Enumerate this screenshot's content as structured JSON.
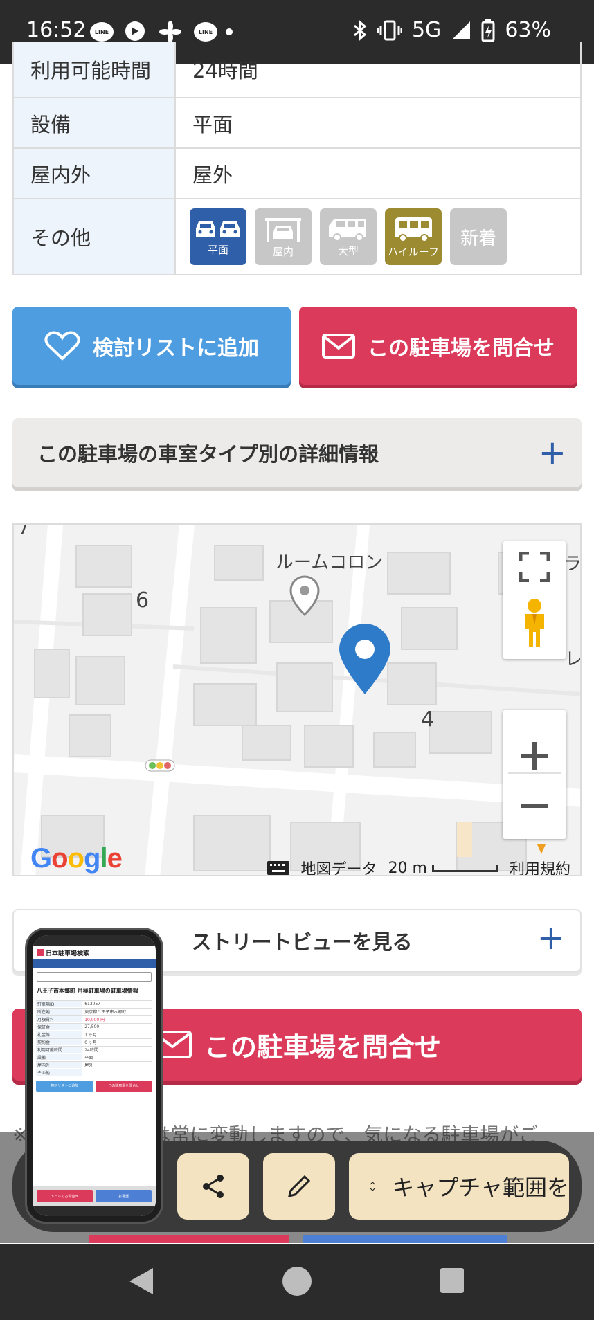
{
  "status_bar": {
    "time": "16:52",
    "network": "5G",
    "battery": "63%",
    "left_icons": [
      "line-icon",
      "chat-icon",
      "pinwheel-icon",
      "line-icon",
      "dot-icon"
    ],
    "right_icons": [
      "bluetooth-icon",
      "vibrate-icon",
      "signal-icon",
      "battery-icon"
    ]
  },
  "detail_table": {
    "rows": [
      {
        "label": "利用可能時間",
        "value": "24時間"
      },
      {
        "label": "設備",
        "value": "平面"
      },
      {
        "label": "屋内外",
        "value": "屋外"
      },
      {
        "label": "その他",
        "value": ""
      }
    ],
    "tags": [
      {
        "label": "平面",
        "state": "active",
        "icon": "flat-parking-icon"
      },
      {
        "label": "屋内",
        "state": "inactive",
        "icon": "indoor-parking-icon"
      },
      {
        "label": "大型",
        "state": "inactive",
        "icon": "large-vehicle-icon"
      },
      {
        "label": "ハイルーフ",
        "state": "active",
        "icon": "high-roof-icon"
      },
      {
        "label": "新着",
        "state": "inactive",
        "icon": ""
      }
    ]
  },
  "actions": {
    "favorite_label": "検討リストに追加",
    "inquiry_label": "この駐車場を問合せ"
  },
  "detail_accordion": {
    "title": "この駐車場の車室タイプ別の詳細情報",
    "toggle": "+"
  },
  "map": {
    "labels": [
      "ルームコロン",
      "6",
      "4",
      "ラ",
      "レ",
      "7"
    ],
    "attribution": "地図データ",
    "scale": "20 m",
    "terms": "利用規約",
    "logo": "Google"
  },
  "street_view": {
    "label": "ストリートビューを見る",
    "toggle": "+"
  },
  "bottom_inquiry": {
    "label": "この駐車場を問合せ"
  },
  "note": "※ 　　　　　報は常に変動しますので、気になる駐車場がご",
  "capture_toolbar": {
    "range_label": "キャプチャ範囲を"
  },
  "thumbnail": {
    "site_name": "日本駐車場検索",
    "title": "八王子市本郷町 月極駐車場の駐車場情報",
    "rows": [
      [
        "駐車場ID",
        "613057"
      ],
      [
        "所在地",
        "東京都八王子市本郷町"
      ],
      [
        "月額賃料",
        "10,000 円"
      ],
      [
        "保証金",
        "27,500"
      ],
      [
        "礼金等",
        "1 ヶ月"
      ],
      [
        "契約金",
        "0 ヶ月"
      ],
      [
        "利用可能時間",
        "24時間"
      ],
      [
        "設備",
        "平面"
      ],
      [
        "屋内外",
        "屋外"
      ],
      [
        "その他",
        ""
      ]
    ],
    "fav": "検討リストに追加",
    "inq": "この駐車場を問合せ",
    "mail": "メールでお問合せ",
    "phone": "お電話"
  },
  "colors": {
    "primary_blue": "#2f5fa8",
    "fav_blue": "#4d9de0",
    "inquiry_red": "#dc3a5a",
    "table_header_bg": "#eef4fb"
  }
}
